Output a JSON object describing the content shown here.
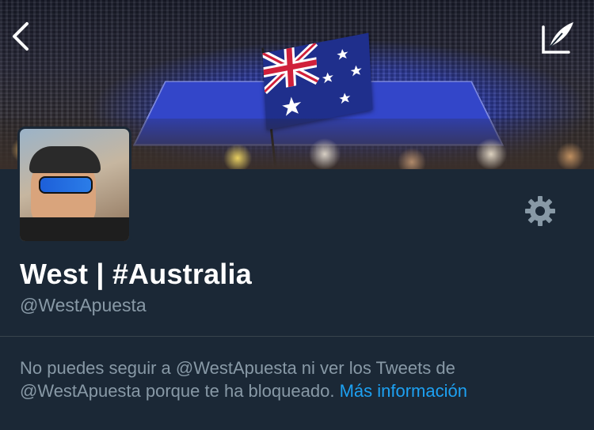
{
  "profile": {
    "display_name": "West | #Australia",
    "handle": "@WestApuesta"
  },
  "blocked_notice": {
    "text": "No puedes seguir a @WestApuesta ni ver los Tweets de @WestApuesta porque te ha bloqueado.",
    "link_label": "Más información"
  },
  "icons": {
    "back": "chevron-left-icon",
    "compose": "compose-tweet-icon",
    "settings": "gear-icon"
  },
  "colors": {
    "background": "#1b2836",
    "primary_text": "#ffffff",
    "secondary_text": "#8899a6",
    "link": "#1da1f2",
    "divider": "#38444d"
  }
}
